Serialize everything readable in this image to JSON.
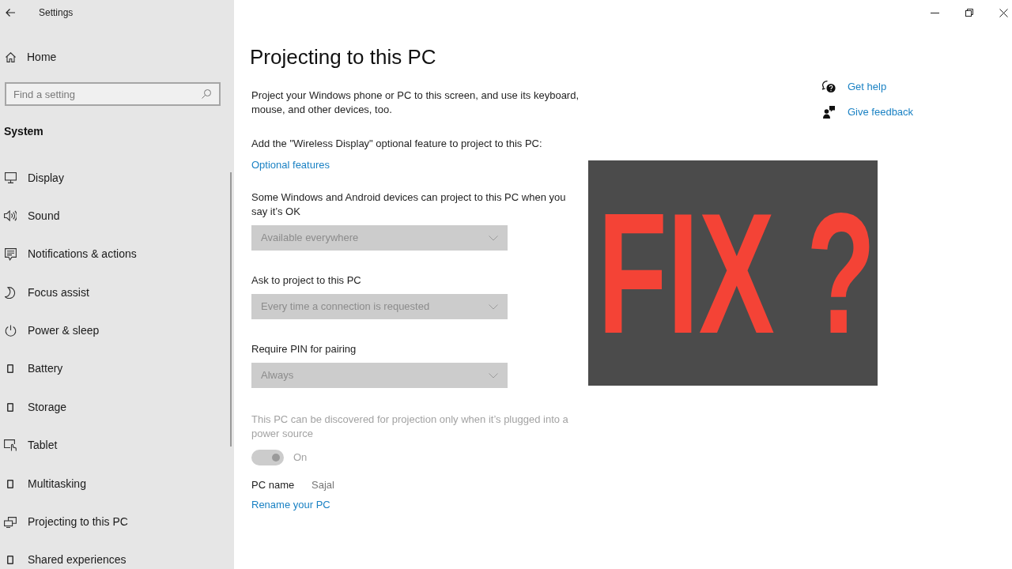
{
  "window": {
    "title": "Settings"
  },
  "sidebar": {
    "home": "Home",
    "search": {
      "placeholder": "Find a setting"
    },
    "section": "System",
    "items": [
      {
        "label": "Display"
      },
      {
        "label": "Sound"
      },
      {
        "label": "Notifications & actions"
      },
      {
        "label": "Focus assist"
      },
      {
        "label": "Power & sleep"
      },
      {
        "label": "Battery"
      },
      {
        "label": "Storage"
      },
      {
        "label": "Tablet"
      },
      {
        "label": "Multitasking"
      },
      {
        "label": "Projecting to this PC"
      },
      {
        "label": "Shared experiences"
      }
    ]
  },
  "page": {
    "title": "Projecting to this PC",
    "description": "Project your Windows phone or PC to this screen, and use its keyboard, mouse, and other devices, too.",
    "feature_note": "Add the \"Wireless Display\" optional feature to project to this PC:",
    "feature_link": "Optional features",
    "settings": [
      {
        "label": "Some Windows and Android devices can project to this PC when you say it’s OK",
        "value": "Available everywhere",
        "disabled": true
      },
      {
        "label": "Ask to project to this PC",
        "value": "Every time a connection is requested",
        "disabled": true
      },
      {
        "label": "Require PIN for pairing",
        "value": "Always",
        "disabled": true
      }
    ],
    "discovery": {
      "text": "This PC can be discovered for projection only when it’s plugged into a power source",
      "disabled": true,
      "toggle": {
        "on": true,
        "label": "On"
      }
    },
    "pc_name": {
      "label": "PC name",
      "value": "Sajal"
    },
    "rename_link": "Rename your PC"
  },
  "help_links": [
    {
      "label": "Get help"
    },
    {
      "label": "Give feedback"
    }
  ],
  "overlay_graphic": {
    "text": "FIX ?"
  }
}
